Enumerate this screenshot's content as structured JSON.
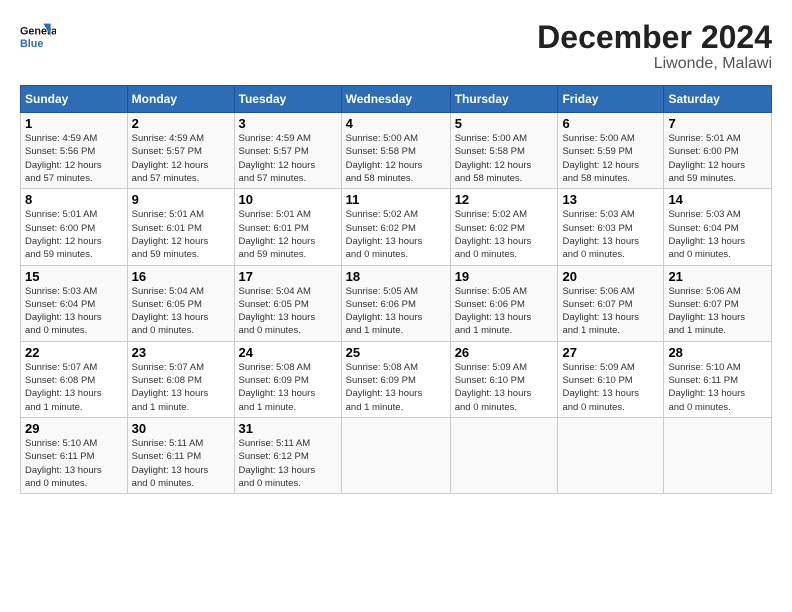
{
  "logo": {
    "line1": "General",
    "line2": "Blue"
  },
  "title": "December 2024",
  "subtitle": "Liwonde, Malawi",
  "headers": [
    "Sunday",
    "Monday",
    "Tuesday",
    "Wednesday",
    "Thursday",
    "Friday",
    "Saturday"
  ],
  "rows": [
    [
      {
        "day": "1",
        "info": "Sunrise: 4:59 AM\nSunset: 5:56 PM\nDaylight: 12 hours\nand 57 minutes."
      },
      {
        "day": "2",
        "info": "Sunrise: 4:59 AM\nSunset: 5:57 PM\nDaylight: 12 hours\nand 57 minutes."
      },
      {
        "day": "3",
        "info": "Sunrise: 4:59 AM\nSunset: 5:57 PM\nDaylight: 12 hours\nand 57 minutes."
      },
      {
        "day": "4",
        "info": "Sunrise: 5:00 AM\nSunset: 5:58 PM\nDaylight: 12 hours\nand 58 minutes."
      },
      {
        "day": "5",
        "info": "Sunrise: 5:00 AM\nSunset: 5:58 PM\nDaylight: 12 hours\nand 58 minutes."
      },
      {
        "day": "6",
        "info": "Sunrise: 5:00 AM\nSunset: 5:59 PM\nDaylight: 12 hours\nand 58 minutes."
      },
      {
        "day": "7",
        "info": "Sunrise: 5:01 AM\nSunset: 6:00 PM\nDaylight: 12 hours\nand 59 minutes."
      }
    ],
    [
      {
        "day": "8",
        "info": "Sunrise: 5:01 AM\nSunset: 6:00 PM\nDaylight: 12 hours\nand 59 minutes."
      },
      {
        "day": "9",
        "info": "Sunrise: 5:01 AM\nSunset: 6:01 PM\nDaylight: 12 hours\nand 59 minutes."
      },
      {
        "day": "10",
        "info": "Sunrise: 5:01 AM\nSunset: 6:01 PM\nDaylight: 12 hours\nand 59 minutes."
      },
      {
        "day": "11",
        "info": "Sunrise: 5:02 AM\nSunset: 6:02 PM\nDaylight: 13 hours\nand 0 minutes."
      },
      {
        "day": "12",
        "info": "Sunrise: 5:02 AM\nSunset: 6:02 PM\nDaylight: 13 hours\nand 0 minutes."
      },
      {
        "day": "13",
        "info": "Sunrise: 5:03 AM\nSunset: 6:03 PM\nDaylight: 13 hours\nand 0 minutes."
      },
      {
        "day": "14",
        "info": "Sunrise: 5:03 AM\nSunset: 6:04 PM\nDaylight: 13 hours\nand 0 minutes."
      }
    ],
    [
      {
        "day": "15",
        "info": "Sunrise: 5:03 AM\nSunset: 6:04 PM\nDaylight: 13 hours\nand 0 minutes."
      },
      {
        "day": "16",
        "info": "Sunrise: 5:04 AM\nSunset: 6:05 PM\nDaylight: 13 hours\nand 0 minutes."
      },
      {
        "day": "17",
        "info": "Sunrise: 5:04 AM\nSunset: 6:05 PM\nDaylight: 13 hours\nand 0 minutes."
      },
      {
        "day": "18",
        "info": "Sunrise: 5:05 AM\nSunset: 6:06 PM\nDaylight: 13 hours\nand 1 minute."
      },
      {
        "day": "19",
        "info": "Sunrise: 5:05 AM\nSunset: 6:06 PM\nDaylight: 13 hours\nand 1 minute."
      },
      {
        "day": "20",
        "info": "Sunrise: 5:06 AM\nSunset: 6:07 PM\nDaylight: 13 hours\nand 1 minute."
      },
      {
        "day": "21",
        "info": "Sunrise: 5:06 AM\nSunset: 6:07 PM\nDaylight: 13 hours\nand 1 minute."
      }
    ],
    [
      {
        "day": "22",
        "info": "Sunrise: 5:07 AM\nSunset: 6:08 PM\nDaylight: 13 hours\nand 1 minute."
      },
      {
        "day": "23",
        "info": "Sunrise: 5:07 AM\nSunset: 6:08 PM\nDaylight: 13 hours\nand 1 minute."
      },
      {
        "day": "24",
        "info": "Sunrise: 5:08 AM\nSunset: 6:09 PM\nDaylight: 13 hours\nand 1 minute."
      },
      {
        "day": "25",
        "info": "Sunrise: 5:08 AM\nSunset: 6:09 PM\nDaylight: 13 hours\nand 1 minute."
      },
      {
        "day": "26",
        "info": "Sunrise: 5:09 AM\nSunset: 6:10 PM\nDaylight: 13 hours\nand 0 minutes."
      },
      {
        "day": "27",
        "info": "Sunrise: 5:09 AM\nSunset: 6:10 PM\nDaylight: 13 hours\nand 0 minutes."
      },
      {
        "day": "28",
        "info": "Sunrise: 5:10 AM\nSunset: 6:11 PM\nDaylight: 13 hours\nand 0 minutes."
      }
    ],
    [
      {
        "day": "29",
        "info": "Sunrise: 5:10 AM\nSunset: 6:11 PM\nDaylight: 13 hours\nand 0 minutes."
      },
      {
        "day": "30",
        "info": "Sunrise: 5:11 AM\nSunset: 6:11 PM\nDaylight: 13 hours\nand 0 minutes."
      },
      {
        "day": "31",
        "info": "Sunrise: 5:11 AM\nSunset: 6:12 PM\nDaylight: 13 hours\nand 0 minutes."
      },
      null,
      null,
      null,
      null
    ]
  ]
}
